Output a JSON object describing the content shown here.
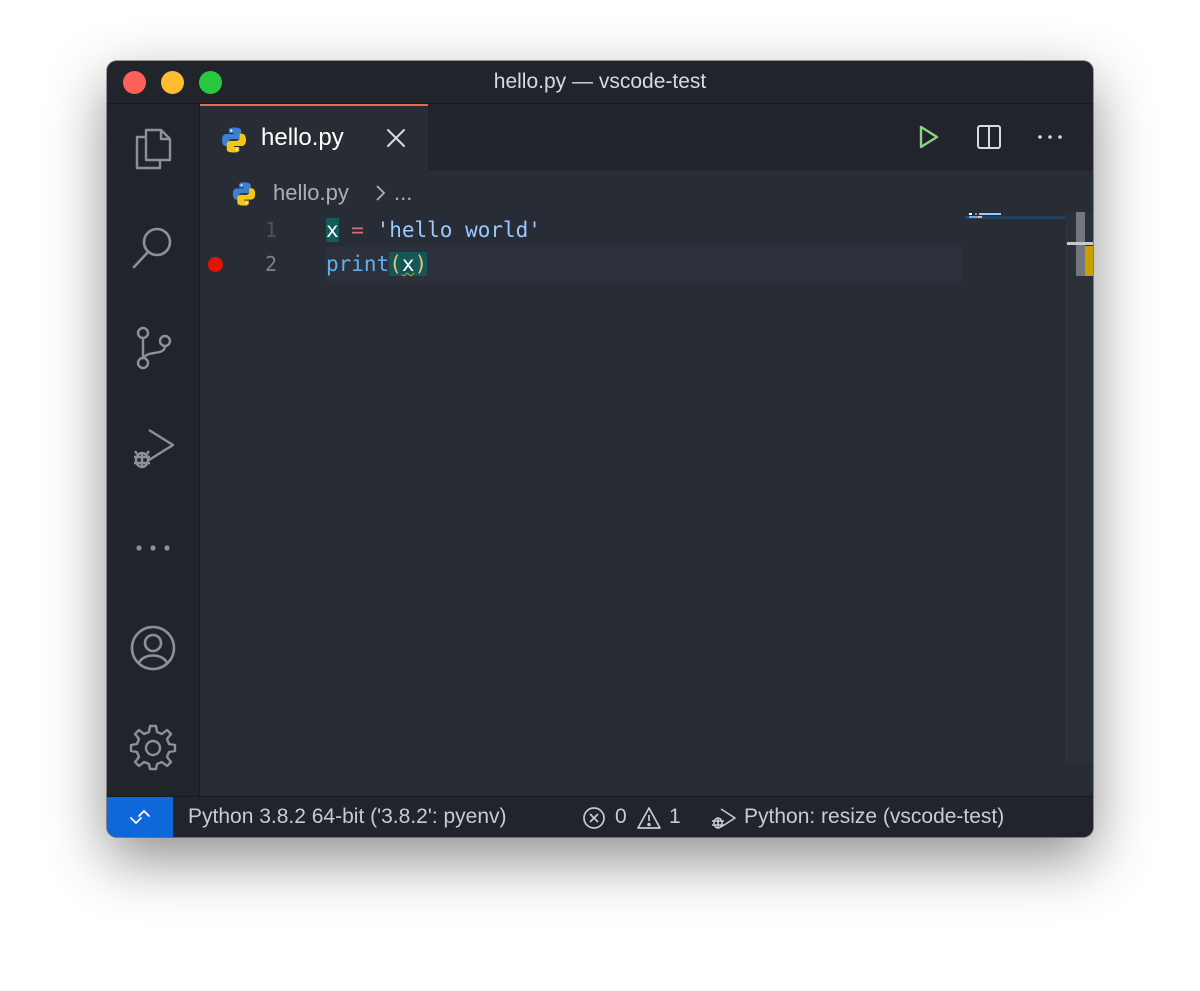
{
  "window": {
    "title": "hello.py — vscode-test"
  },
  "tab": {
    "label": "hello.py"
  },
  "breadcrumb": {
    "file": "hello.py",
    "more": "..."
  },
  "editor": {
    "lines": [
      {
        "number": "1",
        "tokens": {
          "var": "x",
          "op": " = ",
          "str": "'hello world'"
        }
      },
      {
        "number": "2",
        "tokens": {
          "fn": "print",
          "open": "(",
          "arg": "x",
          "close": ")"
        }
      }
    ],
    "breakpoint_line": "2"
  },
  "statusbar": {
    "interpreter": "Python 3.8.2 64-bit ('3.8.2': pyenv)",
    "errors": "0",
    "warnings": "1",
    "debug_config": "Python: resize (vscode-test)"
  },
  "icons": {
    "activity": [
      "files-icon",
      "search-icon",
      "source-control-icon",
      "run-debug-icon",
      "more-icon",
      "account-icon",
      "settings-icon"
    ],
    "tab_actions": [
      "run-icon",
      "split-editor-icon",
      "more-actions-icon"
    ]
  },
  "colors": {
    "accent_tab_border": "#e06c4a",
    "remote_indicator": "#0e68d9",
    "run_green": "#89d185",
    "breakpoint_red": "#e51400",
    "string_blue": "#98c9ff",
    "keyword_red": "#e06c75",
    "function_blue": "#61afef",
    "bracket_yellow": "#e5c07b"
  }
}
